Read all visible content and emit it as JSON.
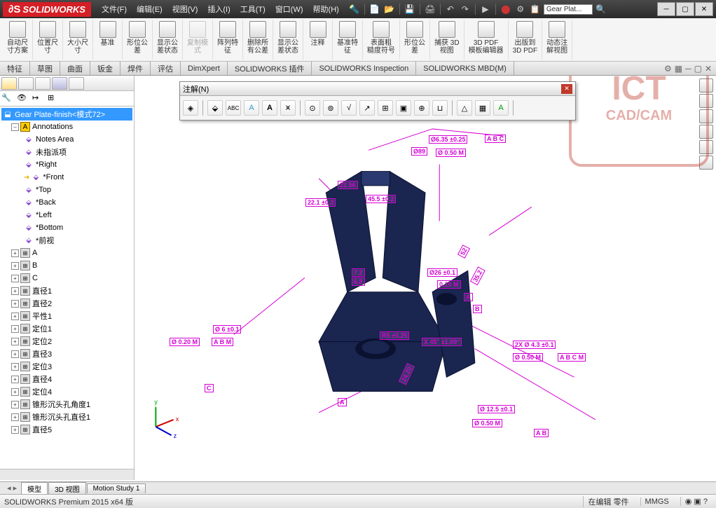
{
  "app": {
    "name": "SOLIDWORKS",
    "title_doc": "Gear Plat..."
  },
  "menu": {
    "file": "文件(F)",
    "edit": "编辑(E)",
    "view": "视图(V)",
    "insert": "插入(I)",
    "tools": "工具(T)",
    "window": "窗口(W)",
    "help": "帮助(H)"
  },
  "ribbon": [
    {
      "l1": "自动尺",
      "l2": "寸方案"
    },
    {
      "l1": "位置尺",
      "l2": "寸"
    },
    {
      "l1": "大小尺",
      "l2": "寸"
    },
    {
      "l1": "基准",
      "l2": ""
    },
    {
      "l1": "形位公",
      "l2": "差"
    },
    {
      "l1": "显示公",
      "l2": "差状态"
    },
    {
      "l1": "复制模",
      "l2": "式",
      "disabled": true
    },
    {
      "l1": "阵列特",
      "l2": "征"
    },
    {
      "l1": "删除所",
      "l2": "有公差"
    },
    {
      "l1": "显示公",
      "l2": "差状态"
    },
    {
      "l1": "注释",
      "l2": ""
    },
    {
      "l1": "基准特",
      "l2": "征"
    },
    {
      "l1": "表面粗",
      "l2": "糙度符号"
    },
    {
      "l1": "形位公",
      "l2": "差"
    },
    {
      "l1": "捕获 3D",
      "l2": "视图"
    },
    {
      "l1": "3D PDF",
      "l2": "模板编辑器"
    },
    {
      "l1": "出版到",
      "l2": "3D PDF"
    },
    {
      "l1": "动态注",
      "l2": "解视图"
    }
  ],
  "tabs": [
    "特征",
    "草图",
    "曲面",
    "钣金",
    "焊件",
    "评估",
    "DimXpert",
    "SOLIDWORKS 插件",
    "SOLIDWORKS Inspection",
    "SOLIDWORKS MBD(M)"
  ],
  "tree": {
    "root": "Gear Plate-finish<模式72>",
    "annotations": "Annotations",
    "items": [
      "Notes Area",
      "未指派项",
      "*Right",
      "*Front",
      "*Top",
      "*Back",
      "*Left",
      "*Bottom",
      "*前视"
    ],
    "fcs": [
      "A",
      "B",
      "C",
      "直径1",
      "直径2",
      "平性1",
      "定位1",
      "定位2",
      "直径3",
      "定位3",
      "直径4",
      "定位4",
      "锥形沉头孔角度1",
      "锥形沉头孔直径1",
      "直径5"
    ]
  },
  "annot_panel": {
    "title": "注解(N)"
  },
  "dimensions": {
    "d1": "Ø6.35 ±0.25",
    "d2": "Ø 0.50 M",
    "d3": "22.56",
    "d4": "22.1 ±0.2",
    "d5": "45.5 ±0.2",
    "d6": "7.2",
    "d7": "6.8",
    "d8": "Ø26 ±0.1",
    "d9": "0.10 M",
    "d10": "R5 ±0.25",
    "d11": "Ø 6 ±0.1",
    "d12": "Ø 0.20 M",
    "d13": "24.20",
    "d14": "X 45° ±1.00°",
    "d15": "2X Ø 4.3 ±0.1",
    "d16": "Ø 0.50 M",
    "d17": "Ø 12.5 ±0.1",
    "d18": "Ø 0.50 M",
    "d19": "A",
    "d20": "B",
    "d21": "C",
    "d22": "M",
    "d23": "35.2",
    "d24": "52",
    "d25": "Ø89",
    "d26": "A B M",
    "d27": "A B C M"
  },
  "bottom_tabs": {
    "model": "模型",
    "view3d": "3D 视图",
    "motion": "Motion Study 1"
  },
  "status": {
    "version": "SOLIDWORKS Premium 2015 x64 版",
    "edit": "在编辑 零件",
    "units": "MMGS"
  },
  "watermark": {
    "main": "ICT",
    "sub": "CAD/CAM"
  }
}
